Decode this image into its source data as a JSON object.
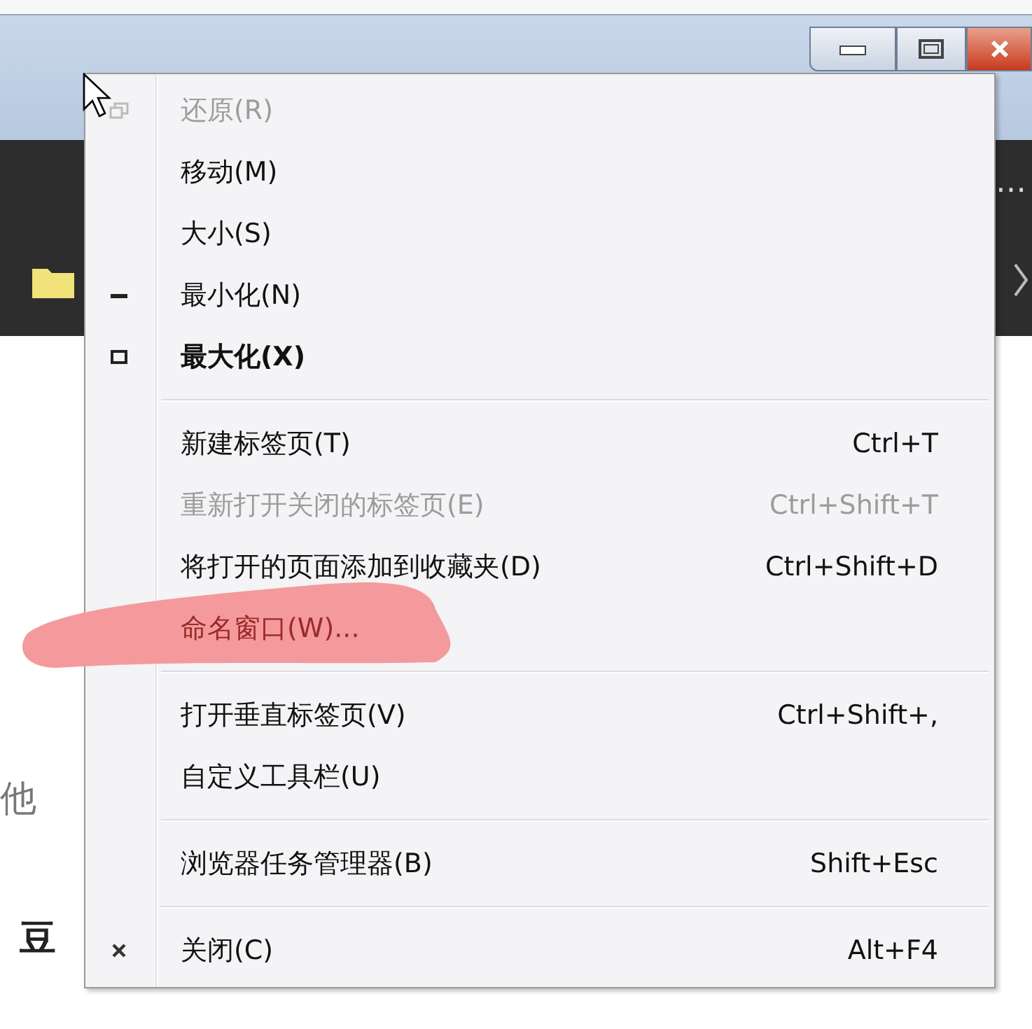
{
  "background_text": [
    {
      "text": "他",
      "bold": false
    },
    {
      "text": "豆",
      "bold": true
    }
  ],
  "context_menu": {
    "groups": [
      {
        "items": [
          {
            "label": "还原(R)",
            "disabled": true,
            "default": false,
            "marked": false,
            "kind": "restore"
          },
          {
            "label": "移动(M)",
            "disabled": false,
            "default": false,
            "marked": false
          },
          {
            "label": "大小(S)",
            "disabled": false,
            "default": false,
            "marked": false
          },
          {
            "label": "最小化(N)",
            "disabled": false,
            "default": false,
            "marked": false,
            "kind": "minimize"
          },
          {
            "label": "最大化(X)",
            "disabled": false,
            "default": true,
            "marked": false,
            "kind": "maximize"
          }
        ]
      },
      {
        "items": [
          {
            "label": "新建标签页(T)",
            "shortcut": "Ctrl+T",
            "disabled": false,
            "default": false,
            "marked": false
          },
          {
            "label": "重新打开关闭的标签页(E)",
            "shortcut": "Ctrl+Shift+T",
            "disabled": true,
            "default": false,
            "marked": false
          },
          {
            "label": "将打开的页面添加到收藏夹(D)",
            "shortcut": "Ctrl+Shift+D",
            "disabled": false,
            "default": false,
            "marked": false
          },
          {
            "label": "命名窗口(W)...",
            "disabled": false,
            "default": false,
            "marked": true
          }
        ]
      },
      {
        "items": [
          {
            "label": "打开垂直标签页(V)",
            "shortcut": "Ctrl+Shift+,",
            "disabled": false,
            "default": false,
            "marked": false
          },
          {
            "label": "自定义工具栏(U)",
            "disabled": false,
            "default": false,
            "marked": false
          }
        ]
      },
      {
        "items": [
          {
            "label": "浏览器任务管理器(B)",
            "shortcut": "Shift+Esc",
            "disabled": false,
            "default": false,
            "marked": false
          }
        ]
      },
      {
        "items": [
          {
            "label": "关闭(C)",
            "shortcut": "Alt+F4",
            "disabled": false,
            "default": false,
            "marked": false,
            "kind": "close"
          }
        ]
      }
    ]
  },
  "ellipsis": "…"
}
